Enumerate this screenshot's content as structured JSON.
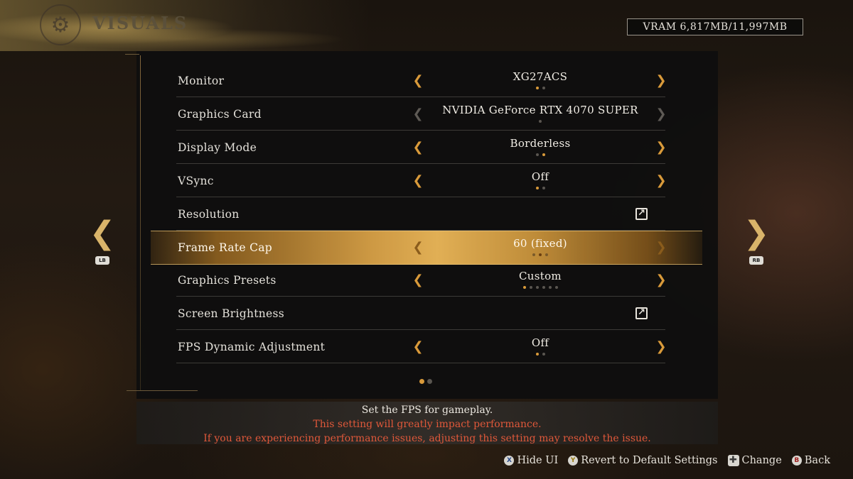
{
  "header": {
    "title": "VISUALS",
    "emblem_icon": "gear-emblem-icon"
  },
  "vram": {
    "text": "VRAM 6,817MB/11,997MB"
  },
  "settings": [
    {
      "label": "Monitor",
      "value": "XG27ACS",
      "type": "selector",
      "arrows_enabled": true,
      "dots": 2,
      "active_dot": 1
    },
    {
      "label": "Graphics Card",
      "value": "NVIDIA GeForce RTX 4070 SUPER",
      "type": "selector",
      "arrows_enabled": false,
      "dots": 1,
      "active_dot": 0
    },
    {
      "label": "Display Mode",
      "value": "Borderless",
      "type": "selector",
      "arrows_enabled": true,
      "dots": 2,
      "active_dot": 2
    },
    {
      "label": "VSync",
      "value": "Off",
      "type": "selector",
      "arrows_enabled": true,
      "dots": 2,
      "active_dot": 1
    },
    {
      "label": "Resolution",
      "value": "",
      "type": "link"
    },
    {
      "label": "Frame Rate Cap",
      "value": "60 (fixed)",
      "type": "selector",
      "arrows_enabled": true,
      "dots": 3,
      "active_dot": 2,
      "selected": true
    },
    {
      "label": "Graphics Presets",
      "value": "Custom",
      "type": "selector",
      "arrows_enabled": true,
      "dots": 6,
      "active_dot": 1
    },
    {
      "label": "Screen Brightness",
      "value": "",
      "type": "link"
    },
    {
      "label": "FPS Dynamic Adjustment",
      "value": "Off",
      "type": "selector",
      "arrows_enabled": true,
      "dots": 2,
      "active_dot": 1
    }
  ],
  "pagination": {
    "pages": 2,
    "current": 1
  },
  "nav": {
    "left_bumper": "LB",
    "right_bumper": "RB"
  },
  "description": {
    "main": "Set the FPS for gameplay.",
    "warning_1": "This setting will greatly impact performance.",
    "warning_2": "If you are experiencing performance issues, adjusting this setting may resolve the issue."
  },
  "footer": [
    {
      "button": "X",
      "label": "Hide UI"
    },
    {
      "button": "Y",
      "label": "Revert to Default Settings"
    },
    {
      "button": "✚",
      "label": "Change"
    },
    {
      "button": "B",
      "label": "Back"
    }
  ],
  "colors": {
    "accent": "#d99a3a",
    "warning": "#e0583a",
    "highlight": "#e1af55"
  }
}
